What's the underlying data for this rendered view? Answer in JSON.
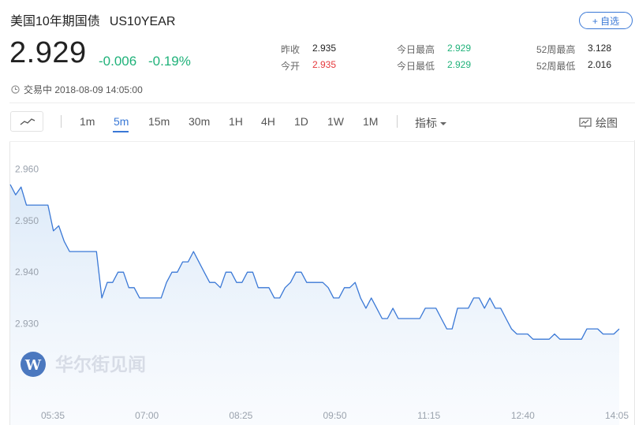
{
  "header": {
    "name": "美国10年期国债",
    "code": "US10YEAR",
    "fav_label": "+ 自选",
    "price": "2.929",
    "change": "-0.006",
    "change_pct": "-0.19%",
    "status": "交易中 2018-08-09 14:05:00"
  },
  "stats": {
    "prev_close_label": "昨收",
    "prev_close": "2.935",
    "open_label": "今开",
    "open": "2.935",
    "day_high_label": "今日最高",
    "day_high": "2.929",
    "day_low_label": "今日最低",
    "day_low": "2.929",
    "w52_high_label": "52周最高",
    "w52_high": "3.128",
    "w52_low_label": "52周最低",
    "w52_low": "2.016"
  },
  "colors": {
    "up": "#e5383b",
    "down": "#20b27a",
    "accent": "#3a78d6",
    "line": "#3a78d6"
  },
  "toolbar": {
    "intervals": [
      "1m",
      "5m",
      "15m",
      "30m",
      "1H",
      "4H",
      "1D",
      "1W",
      "1M"
    ],
    "active_interval": "5m",
    "indicator_label": "指标",
    "draw_label": "绘图",
    "chart_icon": "line-chart-icon",
    "draw_icon": "drawing-board-icon",
    "clock_icon": "clock-icon"
  },
  "watermark": {
    "text": "华尔街见闻",
    "logo_letter": "W"
  },
  "chart_data": {
    "type": "area",
    "x_ticks": [
      "05:35",
      "07:00",
      "08:25",
      "09:50",
      "11:15",
      "12:40",
      "14:05"
    ],
    "y_ticks": [
      "2.960",
      "2.950",
      "2.940",
      "2.930"
    ],
    "ylim": [
      2.9255,
      2.9625
    ],
    "grid": false,
    "legend": false,
    "start_time": "05:10",
    "end_time": "14:05",
    "values": [
      2.957,
      2.955,
      2.9565,
      2.953,
      2.953,
      2.953,
      2.953,
      2.953,
      2.948,
      2.949,
      2.946,
      2.944,
      2.944,
      2.944,
      2.944,
      2.944,
      2.944,
      2.935,
      2.938,
      2.938,
      2.94,
      2.94,
      2.937,
      2.937,
      2.935,
      2.935,
      2.935,
      2.935,
      2.935,
      2.938,
      2.94,
      2.94,
      2.942,
      2.942,
      2.944,
      2.942,
      2.94,
      2.938,
      2.938,
      2.937,
      2.94,
      2.94,
      2.938,
      2.938,
      2.94,
      2.94,
      2.937,
      2.937,
      2.937,
      2.935,
      2.935,
      2.937,
      2.938,
      2.94,
      2.94,
      2.938,
      2.938,
      2.938,
      2.938,
      2.937,
      2.935,
      2.935,
      2.937,
      2.937,
      2.938,
      2.935,
      2.933,
      2.935,
      2.933,
      2.931,
      2.931,
      2.933,
      2.931,
      2.931,
      2.931,
      2.931,
      2.931,
      2.933,
      2.933,
      2.933,
      2.931,
      2.929,
      2.929,
      2.933,
      2.933,
      2.933,
      2.935,
      2.935,
      2.933,
      2.935,
      2.933,
      2.933,
      2.931,
      2.929,
      2.928,
      2.928,
      2.928,
      2.927,
      2.927,
      2.927,
      2.927,
      2.928,
      2.927,
      2.927,
      2.927,
      2.927,
      2.927,
      2.929,
      2.929,
      2.929,
      2.928,
      2.928,
      2.928,
      2.929
    ]
  }
}
